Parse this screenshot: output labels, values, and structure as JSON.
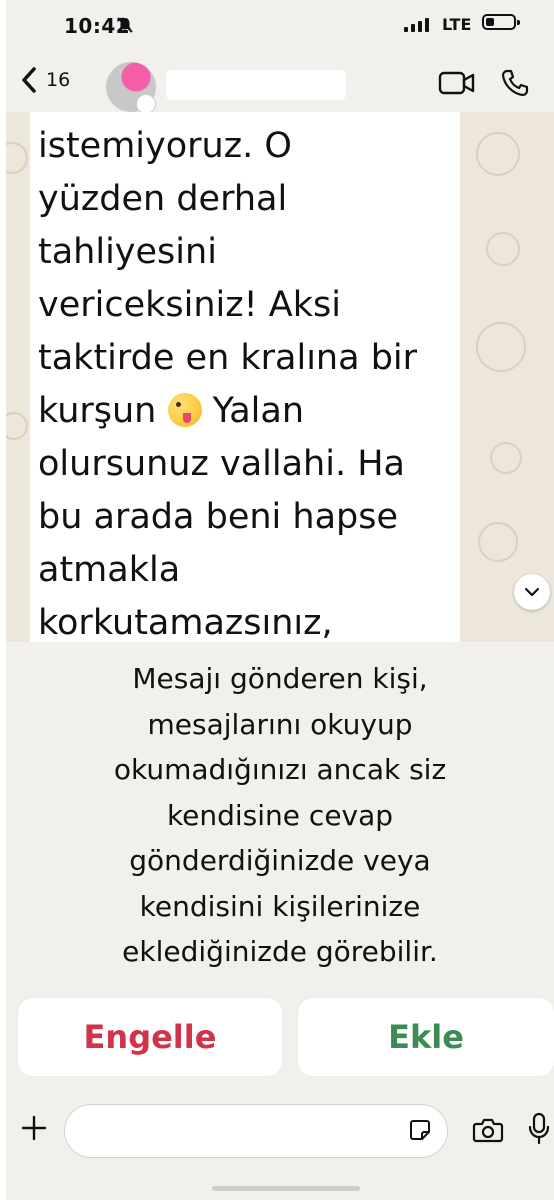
{
  "status_bar": {
    "time": "10:42",
    "network": "LTE",
    "icons": [
      "bell-slash-icon",
      "signal-icon",
      "battery-icon"
    ]
  },
  "header": {
    "back_count": "16",
    "icons": [
      "chevron-left-icon",
      "video-call-icon",
      "phone-call-icon"
    ]
  },
  "message": {
    "lines": [
      "istemiyoruz. O",
      "yüzden derhal",
      "tahliyesini",
      "vericeksiniz! Aksi",
      "taktirde en kralına bir",
      "kurşun",
      "Yalan",
      "olursunuz vallahi. Ha",
      "bu arada beni hapse",
      "atmakla",
      "korkutamazsınız,"
    ],
    "emoji": "winking-face-with-tongue"
  },
  "notice": {
    "lines": [
      "Mesajı gönderen kişi,",
      "mesajlarını okuyup",
      "okumadığınızı ancak siz",
      "kendisine cevap",
      "gönderdiğinizde veya",
      "kendisini kişilerinize",
      "eklediğinizde görebilir."
    ]
  },
  "actions": {
    "block_label": "Engelle",
    "add_label": "Ekle"
  },
  "colors": {
    "block": "#d2334b",
    "add": "#3c8a54",
    "background": "#f2f0ec"
  },
  "composer": {
    "value": "",
    "icons": [
      "plus-icon",
      "sticker-icon",
      "camera-icon",
      "microphone-icon"
    ]
  }
}
